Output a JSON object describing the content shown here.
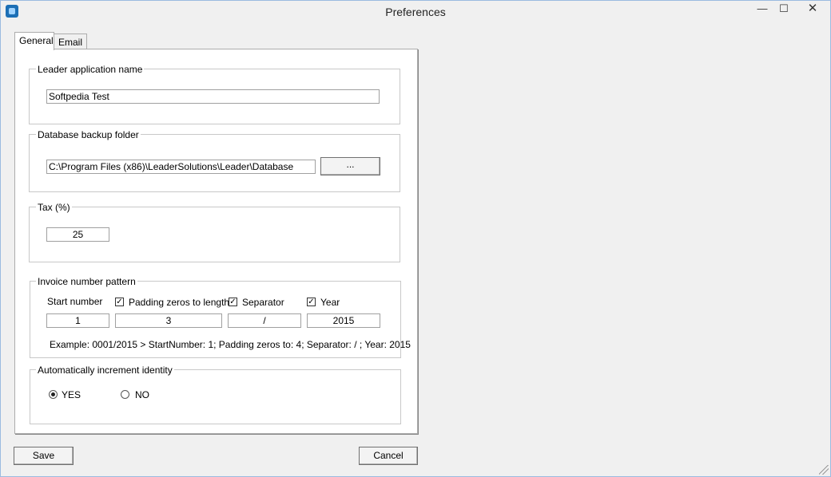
{
  "window": {
    "title": "Preferences",
    "min_glyph": "—",
    "max_glyph": "☐",
    "close_glyph": "✕"
  },
  "tabs": [
    {
      "label": "General"
    },
    {
      "label": "Email"
    }
  ],
  "leader_app": {
    "legend": "Leader application name",
    "value": "Softpedia Test"
  },
  "backup": {
    "legend": "Database backup folder",
    "value": "C:\\Program Files (x86)\\LeaderSolutions\\Leader\\Database",
    "browse_label": "..."
  },
  "tax": {
    "legend": "Tax (%)",
    "value": "25"
  },
  "invoice": {
    "legend": "Invoice number pattern",
    "start_label": "Start number",
    "padding_label": "Padding zeros to length",
    "separator_label": "Separator",
    "year_label": "Year",
    "start_value": "1",
    "padding_value": "3",
    "separator_value": "/",
    "year_value": "2015",
    "example": "Example: 0001/2015 > StartNumber: 1; Padding zeros to: 4; Separator: / ; Year: 2015",
    "check_glyph": "✓"
  },
  "increment": {
    "legend": "Automatically increment identity",
    "yes_label": "YES",
    "no_label": "NO",
    "selected": "YES"
  },
  "footer": {
    "save_label": "Save",
    "cancel_label": "Cancel"
  }
}
